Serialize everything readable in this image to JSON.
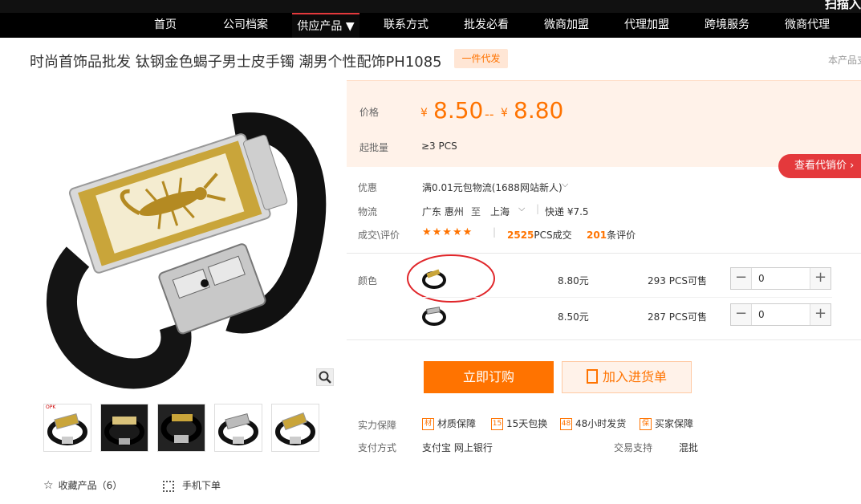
{
  "header": {
    "scan_text": "扫描入",
    "nav": [
      "首页",
      "公司档案",
      "供应产品 ▼",
      "联系方式",
      "批发必看",
      "微商加盟",
      "代理加盟",
      "跨境服务",
      "微商代理"
    ]
  },
  "product": {
    "title": "时尚首饰品批发 钛钢金色蝎子男士皮手镯 潮男个性配饰PH1085",
    "badge": "一件代发",
    "side_note": "本产品支"
  },
  "gallery": {
    "brand_mark": "OPK",
    "favorite_label": "收藏产品（6）",
    "mobile_label": "手机下单"
  },
  "pricing": {
    "price_label": "价格",
    "currency": "¥",
    "price_low": "8.50",
    "separator": "--",
    "price_high": "8.80",
    "moq_label": "起批量",
    "moq_value": "≥3  PCS",
    "view_proxy_button": "查看代销价 ›"
  },
  "details": {
    "promo_label": "优惠",
    "promo_value": "满0.01元包物流(1688网站新人)",
    "logistics_label": "物流",
    "from_city": "广东 惠州",
    "to_word": "至",
    "to_city": "上海",
    "express": "快递 ¥7.5",
    "deal_label": "成交\\评价",
    "stars": "★★★★★",
    "deal_count": "2525",
    "deal_suffix": "PCS成交",
    "review_count": "201",
    "review_suffix": "条评价"
  },
  "variants": {
    "color_label": "颜色",
    "rows": [
      {
        "price": "8.80元",
        "stock": "293 PCS可售",
        "qty": "0",
        "band": "gold"
      },
      {
        "price": "8.50元",
        "stock": "287 PCS可售",
        "qty": "0",
        "band": "silver"
      }
    ]
  },
  "actions": {
    "order_now": "立即订购",
    "add_to_cart": "加入进货单"
  },
  "guarantee": {
    "label": "实力保障",
    "items": [
      {
        "icon": "材",
        "text": "材质保障"
      },
      {
        "icon": "15",
        "text": "15天包换"
      },
      {
        "icon": "48",
        "text": "48小时发货"
      },
      {
        "icon": "保",
        "text": "买家保障"
      }
    ]
  },
  "payment": {
    "label": "支付方式",
    "methods": "支付宝   网上银行",
    "trade_label": "交易支持",
    "trade_value": "混批"
  },
  "colors": {
    "accent": "#ff7300",
    "red": "#e4393c",
    "gold": "#c9a53a"
  }
}
